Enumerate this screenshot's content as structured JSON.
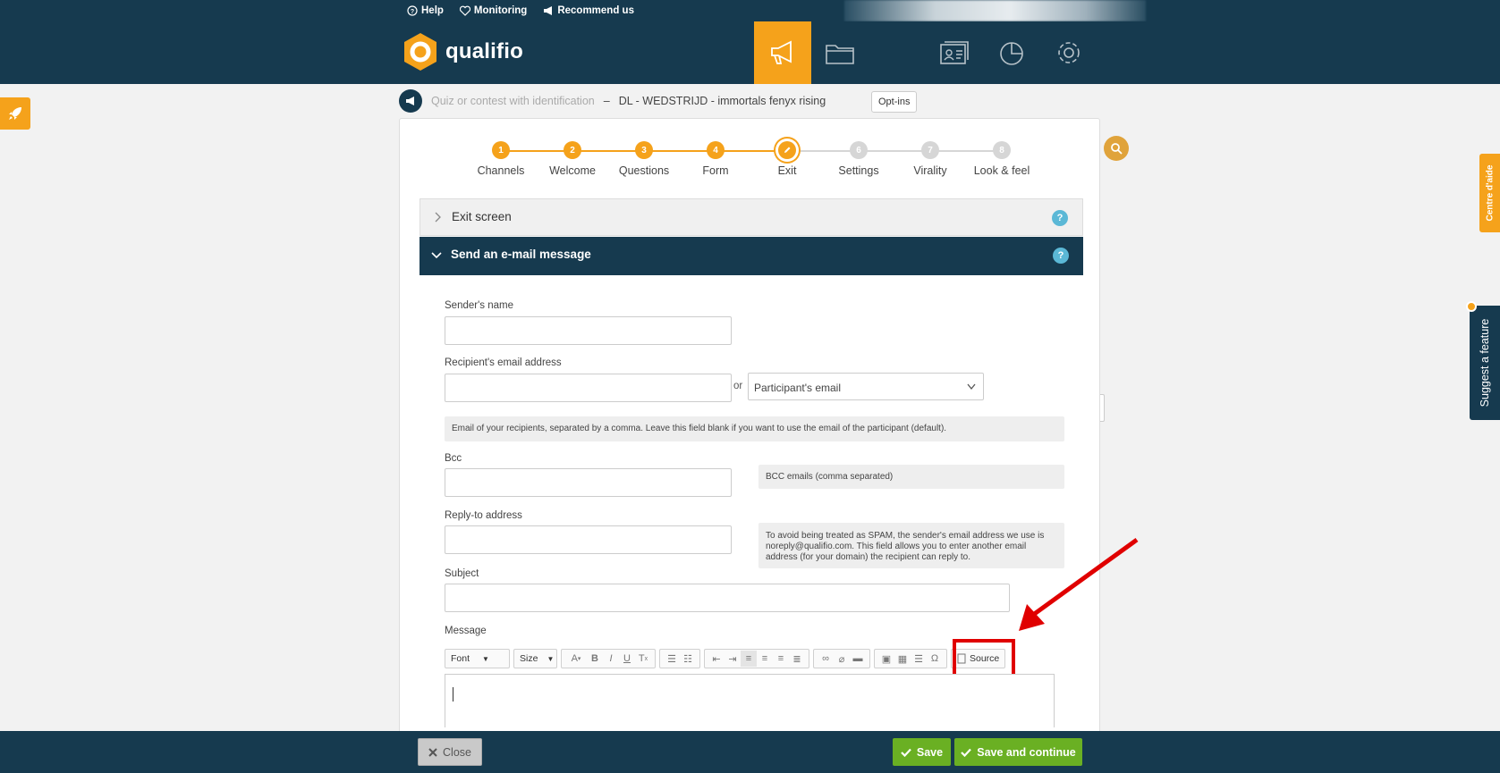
{
  "top_links": {
    "help": "Help",
    "monitoring": "Monitoring",
    "recommend": "Recommend us"
  },
  "brand": {
    "name": "qualifio",
    "accent": "#f5a21b",
    "navy": "#163a4f",
    "green": "#6ab023"
  },
  "nav_icons": [
    "campaign-icon",
    "folder-icon",
    "checkbox-icon",
    "contacts-icon",
    "chart-icon",
    "gear-icon"
  ],
  "tooltip": "Opt-ins",
  "breadcrumb": {
    "type": "Quiz or contest with identification",
    "separator": "–",
    "campaign": "DL - WEDSTRIJD - immortals fenyx rising"
  },
  "steps": [
    {
      "num": "1",
      "label": "Channels",
      "state": "done"
    },
    {
      "num": "2",
      "label": "Welcome",
      "state": "done"
    },
    {
      "num": "3",
      "label": "Questions",
      "state": "done"
    },
    {
      "num": "4",
      "label": "Form",
      "state": "done"
    },
    {
      "num": "",
      "label": "Exit",
      "state": "current"
    },
    {
      "num": "6",
      "label": "Settings",
      "state": "todo"
    },
    {
      "num": "7",
      "label": "Virality",
      "state": "todo"
    },
    {
      "num": "8",
      "label": "Look & feel",
      "state": "todo"
    }
  ],
  "accordion": {
    "exit_screen": "Exit screen",
    "send_email": "Send an e-mail message",
    "help": "?"
  },
  "form": {
    "sender_name_label": "Sender's name",
    "recipient_label": "Recipient's email address",
    "or": "or",
    "recipient_select": "Participant's email",
    "recipient_hint": "Email of your recipients, separated by a comma. Leave this field blank if you want to use the email of the participant (default).",
    "bcc_label": "Bcc",
    "bcc_hint": "BCC emails (comma separated)",
    "reply_to_label": "Reply-to address",
    "reply_to_hint": "To avoid being treated as SPAM, the sender's email address we use is noreply@qualifio.com. This field allows you to enter another email address (for your domain) the recipient can reply to.",
    "subject_label": "Subject",
    "message_label": "Message"
  },
  "editor_toolbar": {
    "font": "Font",
    "size": "Size",
    "source": "Source"
  },
  "footer": {
    "close": "Close",
    "save": "Save",
    "save_continue": "Save and continue"
  },
  "side_tabs": {
    "help_center": "Centre d'aide",
    "suggest": "Suggest a feature"
  }
}
